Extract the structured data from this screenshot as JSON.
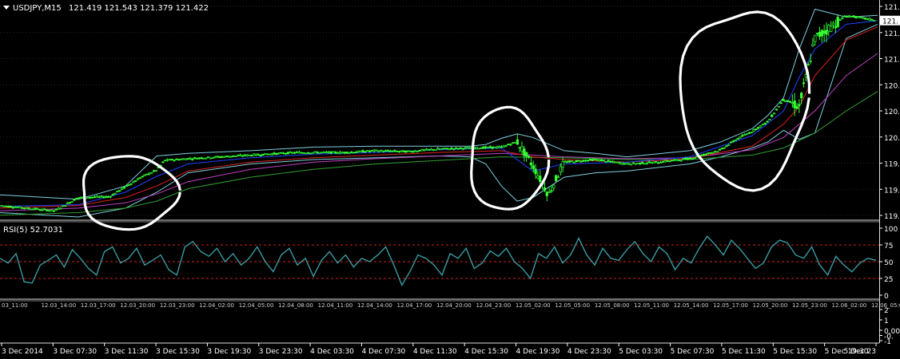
{
  "main_header": {
    "symbol": "USDJPY,M15",
    "ohlc": "121.419 121.543 121.379 121.422"
  },
  "rsi_header": "RSI(5) 52.7031",
  "colors": {
    "background": "#000000",
    "candle": "#33ff33",
    "bollinger": "#7fd0e0",
    "ma_fast": "#2040ff",
    "ma_mid": "#e02020",
    "ma_slow": "#c040c0",
    "ma_long": "#30a030",
    "rsi": "#3a9aa0",
    "rsi_level": "#cc2020",
    "circle": "#ffffff",
    "text": "#ffffff"
  },
  "chart_data": [
    {
      "type": "candlestick",
      "title": "USDJPY,M15",
      "ohlc_last": {
        "open": 121.419,
        "high": 121.543,
        "low": 121.379,
        "close": 121.422
      },
      "y_ticks": [
        "121.",
        "121.",
        "121.",
        "120.",
        "120.",
        "120.",
        "119.",
        "119.",
        "119."
      ],
      "current_price_tag": "121.",
      "ylim": [
        119.2,
        121.6
      ],
      "close_path": {
        "x": [
          0,
          3.5,
          5,
          7,
          9,
          10,
          10.5,
          12,
          14,
          17,
          19,
          22,
          24,
          26,
          28,
          30,
          32,
          33,
          34,
          35,
          36,
          38,
          40,
          42,
          44,
          46,
          47,
          48,
          49,
          50,
          51,
          52,
          54,
          56
        ],
        "y": [
          119.33,
          119.27,
          119.42,
          119.43,
          119.65,
          119.73,
          119.84,
          119.86,
          119.88,
          119.91,
          119.93,
          119.93,
          119.95,
          119.94,
          119.97,
          119.98,
          119.99,
          120.05,
          119.78,
          119.45,
          119.82,
          119.85,
          119.8,
          119.82,
          119.86,
          119.96,
          120.08,
          120.17,
          120.28,
          120.53,
          120.45,
          121.22,
          121.48,
          121.42
        ]
      },
      "bollinger_upper": {
        "x": [
          0,
          5,
          8,
          10,
          12,
          16,
          20,
          24,
          28,
          30,
          31,
          32,
          33,
          34,
          36,
          38,
          40,
          44,
          46,
          48,
          49,
          50,
          51,
          52,
          54,
          56
        ],
        "y": [
          119.45,
          119.4,
          119.55,
          119.89,
          119.92,
          119.95,
          119.99,
          120.0,
          120.0,
          120.0,
          120.02,
          120.09,
          120.14,
          120.1,
          119.95,
          119.92,
          119.88,
          119.95,
          120.05,
          120.2,
          120.35,
          120.55,
          121.1,
          121.55,
          121.46,
          121.48
        ]
      },
      "bollinger_lower": {
        "x": [
          0,
          5,
          8,
          10,
          12,
          16,
          20,
          24,
          28,
          30,
          31,
          32,
          33,
          34,
          36,
          38,
          40,
          44,
          46,
          48,
          49,
          50,
          51,
          52,
          54,
          56
        ],
        "y": [
          119.25,
          119.2,
          119.3,
          119.48,
          119.7,
          119.8,
          119.85,
          119.87,
          119.89,
          119.88,
          119.8,
          119.55,
          119.38,
          119.42,
          119.65,
          119.7,
          119.72,
          119.8,
          119.88,
          119.98,
          120.05,
          120.18,
          120.08,
          120.15,
          121.22,
          121.38
        ]
      },
      "ma_fast": {
        "x": [
          0,
          5,
          8,
          10,
          12,
          16,
          20,
          24,
          28,
          32,
          34,
          36,
          40,
          44,
          48,
          50,
          51,
          52,
          54,
          56
        ],
        "y": [
          119.32,
          119.34,
          119.48,
          119.66,
          119.8,
          119.87,
          119.91,
          119.93,
          119.96,
          119.98,
          119.72,
          119.8,
          119.82,
          119.88,
          120.12,
          120.4,
          120.78,
          121.1,
          121.38,
          121.42
        ]
      },
      "ma_mid": {
        "x": [
          0,
          5,
          8,
          10,
          12,
          16,
          20,
          24,
          28,
          32,
          34,
          36,
          40,
          44,
          48,
          50,
          51,
          52,
          54,
          56
        ],
        "y": [
          119.3,
          119.33,
          119.42,
          119.55,
          119.72,
          119.82,
          119.87,
          119.9,
          119.93,
          119.95,
          119.88,
          119.85,
          119.82,
          119.86,
          120.0,
          120.25,
          120.45,
          120.8,
          121.2,
          121.35
        ]
      },
      "ma_slow": {
        "x": [
          0,
          5,
          8,
          10,
          12,
          16,
          20,
          24,
          28,
          32,
          34,
          36,
          40,
          44,
          48,
          50,
          52,
          54,
          56
        ],
        "y": [
          119.27,
          119.3,
          119.36,
          119.46,
          119.6,
          119.74,
          119.82,
          119.86,
          119.89,
          119.92,
          119.9,
          119.88,
          119.86,
          119.87,
          119.96,
          120.1,
          120.4,
          120.8,
          121.05
        ]
      },
      "ma_long": {
        "x": [
          0,
          5,
          8,
          10,
          12,
          16,
          20,
          24,
          28,
          32,
          36,
          40,
          44,
          48,
          50,
          52,
          54,
          56
        ],
        "y": [
          119.22,
          119.25,
          119.3,
          119.38,
          119.52,
          119.65,
          119.74,
          119.8,
          119.84,
          119.88,
          119.87,
          119.85,
          119.85,
          119.9,
          119.98,
          120.15,
          120.4,
          120.62
        ]
      },
      "x_labels": [
        "3 Dec 2014",
        "3 Dec 07:30",
        "3 Dec 11:30",
        "3 Dec 15:30",
        "3 Dec 19:30",
        "3 Dec 23:30",
        "4 Dec 03:30",
        "4 Dec 07:30",
        "4 Dec 11:30",
        "4 Dec 15:30",
        "4 Dec 19:30",
        "4 Dec 23:30",
        "5 Dec 03:30",
        "5 Dec 07:30",
        "5 Dec 11:30",
        "5 Dec 15:30",
        "5 Dec 19:30",
        "5 Dec 23"
      ],
      "annotations": [
        "circle",
        "circle",
        "circle"
      ]
    },
    {
      "type": "line",
      "title": "RSI(5) 52.7031",
      "ylim": [
        0,
        100
      ],
      "y_ticks": [
        "100",
        "75",
        "50",
        "25",
        "0"
      ],
      "levels": [
        75,
        50,
        25
      ],
      "values": [
        55,
        48,
        62,
        20,
        18,
        45,
        52,
        60,
        42,
        68,
        55,
        40,
        30,
        65,
        72,
        48,
        55,
        70,
        45,
        52,
        60,
        38,
        30,
        72,
        80,
        65,
        58,
        70,
        50,
        62,
        45,
        55,
        72,
        50,
        35,
        60,
        70,
        45,
        55,
        28,
        52,
        65,
        48,
        60,
        42,
        55,
        50,
        60,
        72,
        45,
        15,
        35,
        60,
        55,
        45,
        30,
        62,
        55,
        70,
        40,
        48,
        66,
        58,
        70,
        50,
        40,
        25,
        62,
        55,
        72,
        48,
        60,
        85,
        60,
        45,
        70,
        55,
        52,
        68,
        80,
        62,
        50,
        72,
        62,
        38,
        55,
        48,
        70,
        88,
        75,
        60,
        82,
        70,
        55,
        40,
        48,
        72,
        82,
        78,
        60,
        55,
        72,
        45,
        30,
        58,
        45,
        35,
        48,
        55,
        52
      ]
    },
    {
      "type": "line",
      "title": "",
      "ylim": [
        -1,
        2
      ],
      "y_ticks": [
        "2",
        "1",
        "0.00",
        "-0.",
        "-1"
      ],
      "values": []
    }
  ],
  "time_axis_labels": [
    "03_11:00",
    "12.03_14:00",
    "12.03_17:00",
    "12.03_20:00",
    "12.03_23:00",
    "12.04_02:00",
    "12.04_05:00",
    "12.04_08:00",
    "12.04_11:00",
    "12.04_14:00",
    "12.04_17:00",
    "12.04_20:00",
    "12.04_23:00",
    "12.05_02:00",
    "12.05_05:00",
    "12.05_08:00",
    "12.05_11:00",
    "12.05_14:00",
    "12.05_17:00",
    "12.05_20:00",
    "12.05_23:00",
    "12.06_02:00",
    "12.06_05:00"
  ]
}
